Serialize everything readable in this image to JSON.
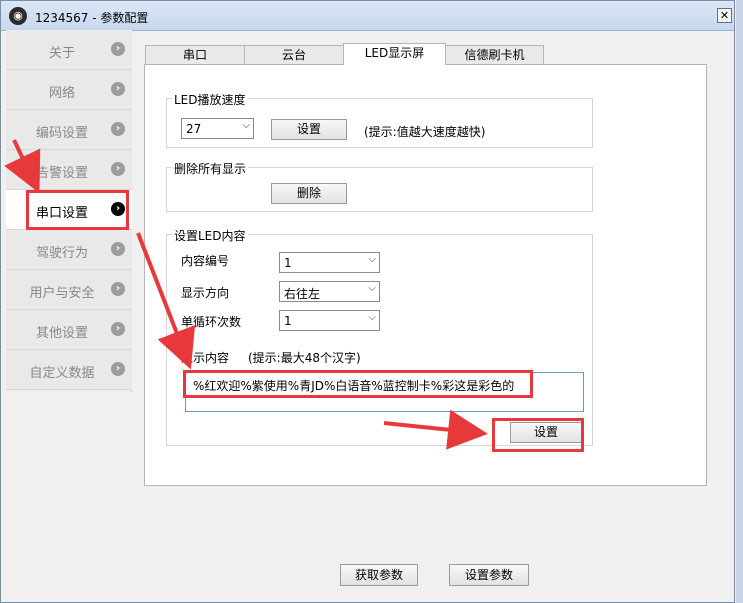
{
  "window": {
    "title": "1234567 - 参数配置",
    "logo_glyph": "◉",
    "close_glyph": "✕"
  },
  "sidebar": {
    "items": [
      {
        "label": "关于"
      },
      {
        "label": "网络"
      },
      {
        "label": "编码设置"
      },
      {
        "label": "告警设置"
      },
      {
        "label": "串口设置",
        "active": true
      },
      {
        "label": "驾驶行为"
      },
      {
        "label": "用户与安全"
      },
      {
        "label": "其他设置"
      },
      {
        "label": "自定义数据"
      }
    ],
    "chevron_glyph": "›"
  },
  "tabs": [
    {
      "label": "串口"
    },
    {
      "label": "云台"
    },
    {
      "label": "LED显示屏",
      "selected": true
    },
    {
      "label": "信德刷卡机"
    }
  ],
  "led_speed": {
    "title": "LED播放速度",
    "value": "27",
    "set_label": "设置",
    "hint": "(提示:值越大速度越快)"
  },
  "delete_all": {
    "title": "删除所有显示",
    "delete_label": "删除"
  },
  "led_content": {
    "title": "设置LED内容",
    "content_no_label": "内容编号",
    "content_no_value": "1",
    "direction_label": "显示方向",
    "direction_value": "右往左",
    "loop_label": "单循环次数",
    "loop_value": "1",
    "content_label": "显示内容",
    "content_hint": "(提示:最大48个汉字)",
    "content_value": "%红欢迎%紫使用%青JD%白语音%蓝控制卡%彩这是彩色的",
    "set_label": "设置"
  },
  "footer": {
    "get_params_label": "获取参数",
    "set_params_label": "设置参数"
  },
  "dropdown_glyph": "⌵",
  "colors": {
    "annotation": "#e8393a",
    "input_border": "#6f95c5"
  }
}
